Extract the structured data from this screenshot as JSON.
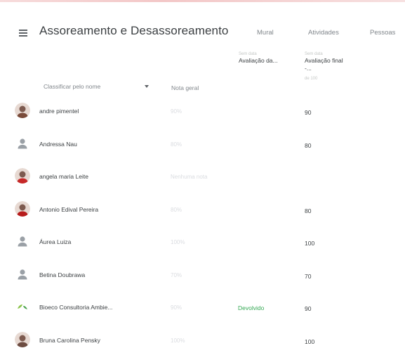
{
  "header": {
    "title": "Assoreamento e Desassoreamento",
    "menu_icon": "hamburger-menu-icon",
    "nav": [
      {
        "label": "Mural"
      },
      {
        "label": "Atividades"
      },
      {
        "label": "Pessoas"
      }
    ]
  },
  "table": {
    "sort_label": "Classificar pelo nome",
    "overall_header": "Nota geral",
    "assignments": [
      {
        "kicker": "Sem data",
        "title": "Avaliação da..."
      },
      {
        "kicker": "Sem data",
        "title": "Avaliação final -...",
        "sub": "de 100"
      }
    ],
    "students": [
      {
        "name": "andre pimentel",
        "overall": "90%",
        "status": "",
        "grade": "90",
        "avatar": "photo-avatar"
      },
      {
        "name": "Andressa Nau",
        "overall": "80%",
        "status": "",
        "grade": "80",
        "avatar": "default-avatar"
      },
      {
        "name": "angela maria Leite",
        "overall": "Nenhuma nota",
        "status": "",
        "grade": "",
        "avatar": "photo-avatar"
      },
      {
        "name": "Antonio Edival Pereira",
        "overall": "80%",
        "status": "",
        "grade": "80",
        "avatar": "photo-avatar"
      },
      {
        "name": "Áurea Luiza",
        "overall": "100%",
        "status": "",
        "grade": "100",
        "avatar": "default-avatar"
      },
      {
        "name": "Betina Doubrawa",
        "overall": "70%",
        "status": "",
        "grade": "70",
        "avatar": "default-avatar"
      },
      {
        "name": "Bioeco Consultoria Ambie...",
        "overall": "90%",
        "status": "Devolvido",
        "grade": "90",
        "avatar": "logo-avatar"
      },
      {
        "name": "Bruna Carolina Pensky",
        "overall": "100%",
        "status": "",
        "grade": "100",
        "avatar": "photo-avatar"
      }
    ]
  },
  "colors": {
    "returned_status": "#34a853",
    "faded_text": "#dadce0"
  }
}
